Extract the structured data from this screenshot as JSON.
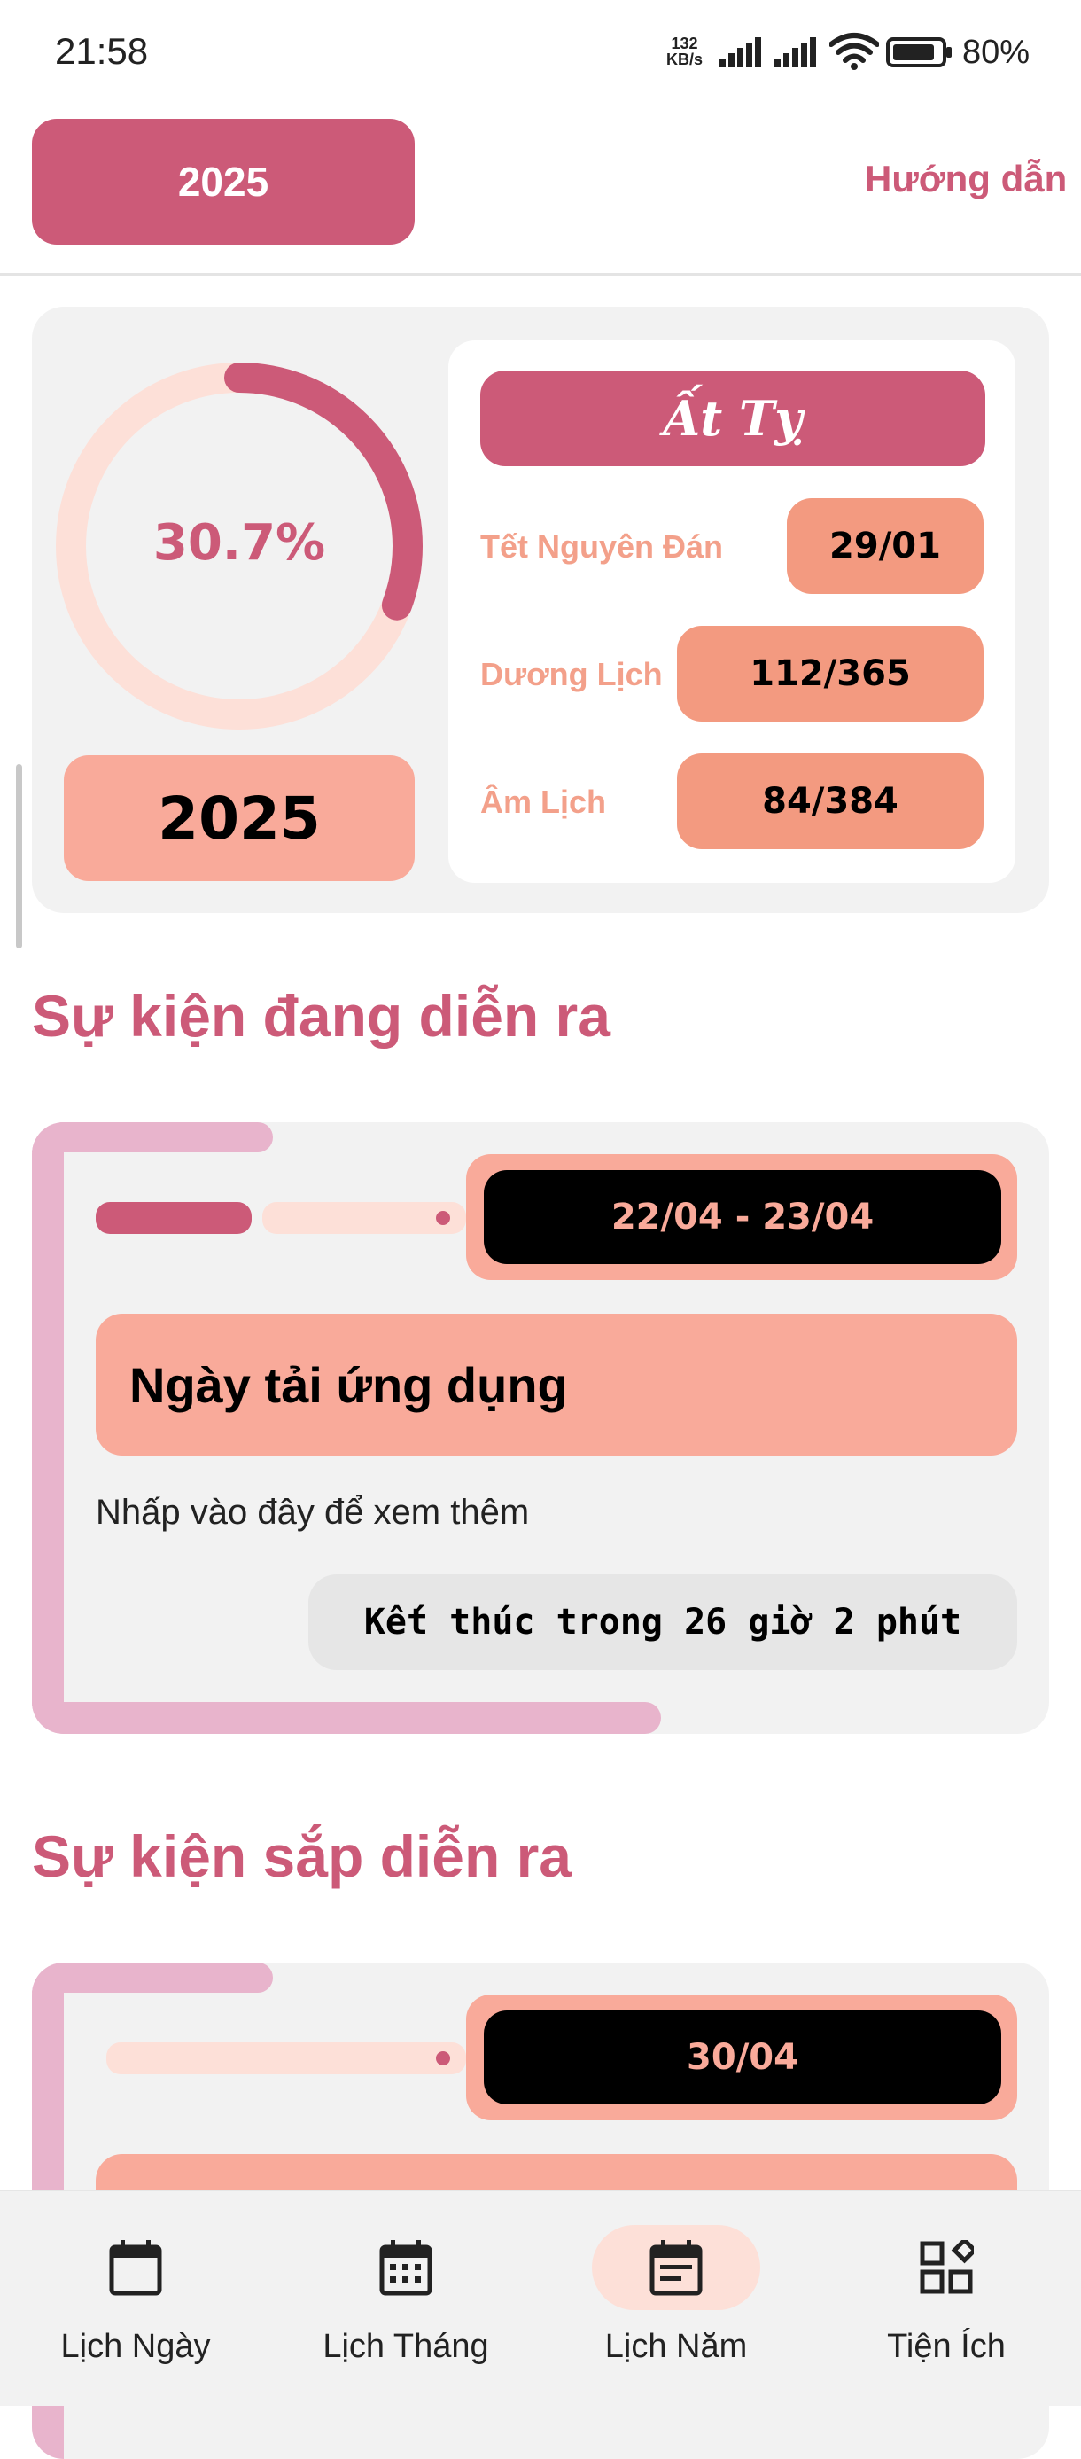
{
  "status_bar": {
    "time": "21:58",
    "net_speed_value": "132",
    "net_speed_unit": "KB/s",
    "battery": "80%"
  },
  "header": {
    "year_button": "2025",
    "guide_link": "Hướng dẫn"
  },
  "summary": {
    "progress_percent": "30.7%",
    "progress_fraction": 0.307,
    "year": "2025",
    "zodiac": "Ất Tỵ",
    "rows": [
      {
        "label": "Tết Nguyên Đán",
        "value": "29/01"
      },
      {
        "label": "Dương Lịch",
        "value": "112/365"
      },
      {
        "label": "Âm Lịch",
        "value": "84/384"
      }
    ]
  },
  "ongoing": {
    "section_title": "Sự kiện đang diễn ra",
    "event": {
      "date_range": "22/04 - 23/04",
      "title": "Ngày tải ứng dụng",
      "subtitle": "Nhấp vào đây để xem thêm",
      "countdown": "Kết thúc trong 26 giờ 2 phút"
    }
  },
  "upcoming": {
    "section_title": "Sự kiện sắp diễn ra",
    "event": {
      "date": "30/04"
    }
  },
  "bottom_nav": {
    "items": [
      {
        "label": "Lịch Ngày",
        "icon": "calendar-blank-icon",
        "active": false
      },
      {
        "label": "Lịch Tháng",
        "icon": "calendar-month-icon",
        "active": false
      },
      {
        "label": "Lịch Năm",
        "icon": "calendar-event-icon",
        "active": true
      },
      {
        "label": "Tiện Ích",
        "icon": "widgets-icon",
        "active": false
      }
    ]
  },
  "colors": {
    "primary": "#cc5a78",
    "salmon": "#f9aa9a",
    "salmon_dark": "#f39a80",
    "light_pink": "#fde0d8",
    "card_bg": "#f2f2f2",
    "accent_bar": "#e8b4cc"
  }
}
